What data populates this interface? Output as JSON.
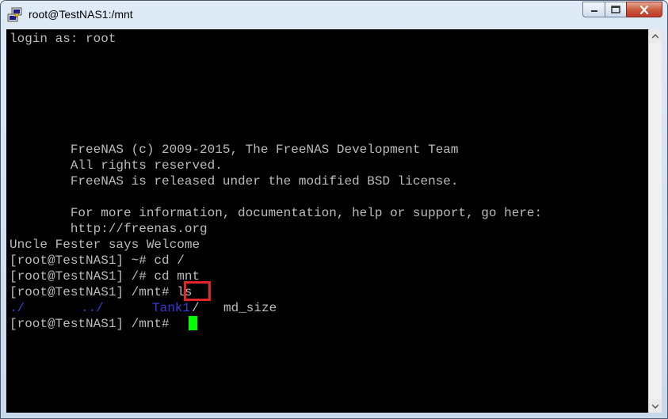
{
  "window": {
    "title": "root@TestNAS1:/mnt",
    "controls": [
      "minimize",
      "maximize",
      "close"
    ]
  },
  "terminal": {
    "lines": [
      "login as: root",
      "",
      "",
      "",
      "",
      "",
      "        FreeNAS (c) 2009-2015, The FreeNAS Development Team",
      "        All rights reserved.",
      "        FreeNAS is released under the modified BSD license.",
      "",
      "        For more information, documentation, help or support, go here:",
      "        http://freenas.org",
      "Uncle Fester says Welcome",
      "[root@TestNAS1] ~# cd /",
      "[root@TestNAS1] /# cd mnt",
      "[root@TestNAS1] /mnt# ls"
    ],
    "ls_output": {
      "dir1": "./",
      "dir2": "../",
      "dir3": "Tank1",
      "dir3_suffix": "/",
      "file1": "md_size"
    },
    "final_prompt": "[root@TestNAS1] /mnt# "
  },
  "colors": {
    "background": "#000000",
    "text": "#bbbbbb",
    "directory": "#3a3adf",
    "cursor": "#00ff00",
    "highlight_box": "#e02626"
  }
}
